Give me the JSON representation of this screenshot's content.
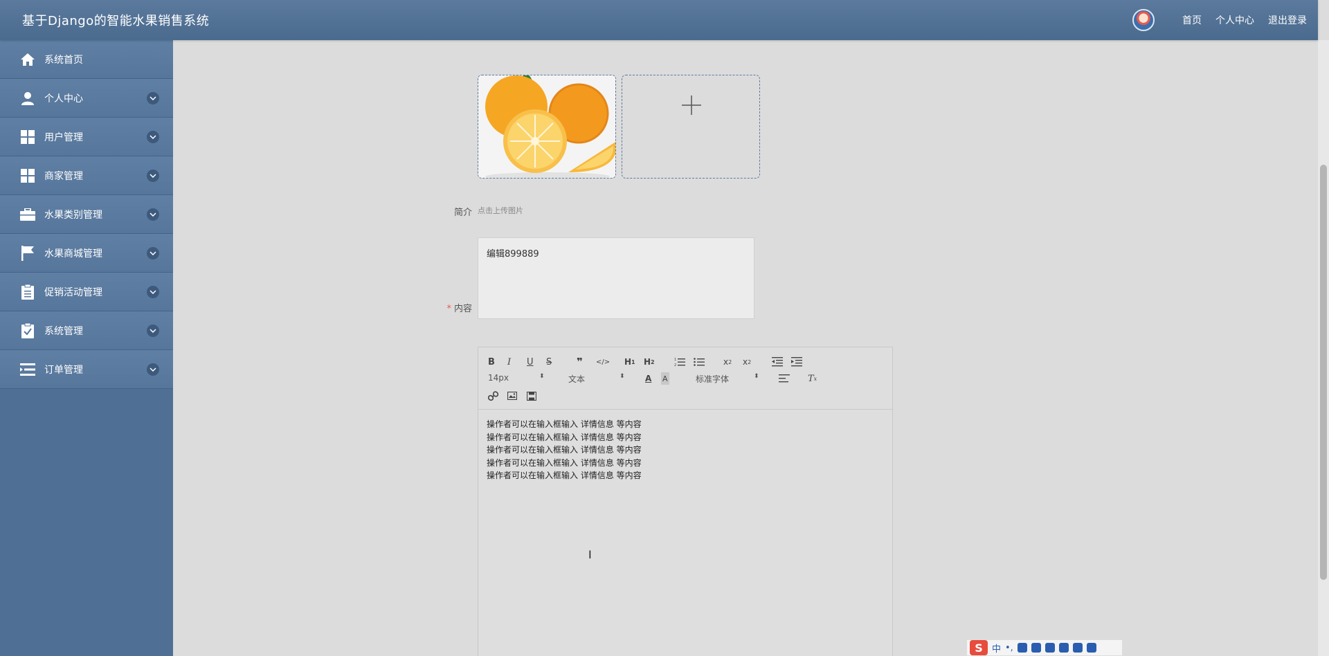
{
  "app": {
    "title": "基于Django的智能水果销售系统"
  },
  "topbar": {
    "links": [
      "首页",
      "个人中心",
      "退出登录"
    ]
  },
  "sidebar": {
    "items": [
      {
        "label": "系统首页",
        "icon": "home-icon",
        "has_children": false
      },
      {
        "label": "个人中心",
        "icon": "user-icon",
        "has_children": true
      },
      {
        "label": "用户管理",
        "icon": "grid-icon",
        "has_children": true
      },
      {
        "label": "商家管理",
        "icon": "grid-icon",
        "has_children": true
      },
      {
        "label": "水果类别管理",
        "icon": "briefcase-icon",
        "has_children": true
      },
      {
        "label": "水果商城管理",
        "icon": "flag-icon",
        "has_children": true
      },
      {
        "label": "促销活动管理",
        "icon": "clipboard-icon",
        "has_children": true
      },
      {
        "label": "系统管理",
        "icon": "clipboard-check-icon",
        "has_children": true
      },
      {
        "label": "订单管理",
        "icon": "list-icon",
        "has_children": true
      }
    ]
  },
  "form": {
    "upload_hint": "点击上传图片",
    "intro_label": "简介",
    "intro_value": "编辑899889",
    "content_label": "内容",
    "content_required": "*"
  },
  "editor": {
    "size_select": "14px",
    "header_select": "文本",
    "font_select": "标准字体",
    "lines": [
      "操作者可以在输入框输入  详情信息  等内容",
      "操作者可以在输入框输入  详情信息  等内容",
      "操作者可以在输入框输入  详情信息  等内容",
      "操作者可以在输入框输入  详情信息  等内容",
      "操作者可以在输入框输入  详情信息  等内容"
    ]
  },
  "ime": {
    "mode": "中",
    "punct": "•,"
  },
  "colors": {
    "topbar": "#4a6a8e",
    "sidebar": "#4f6f95",
    "required": "#e85a4f"
  }
}
